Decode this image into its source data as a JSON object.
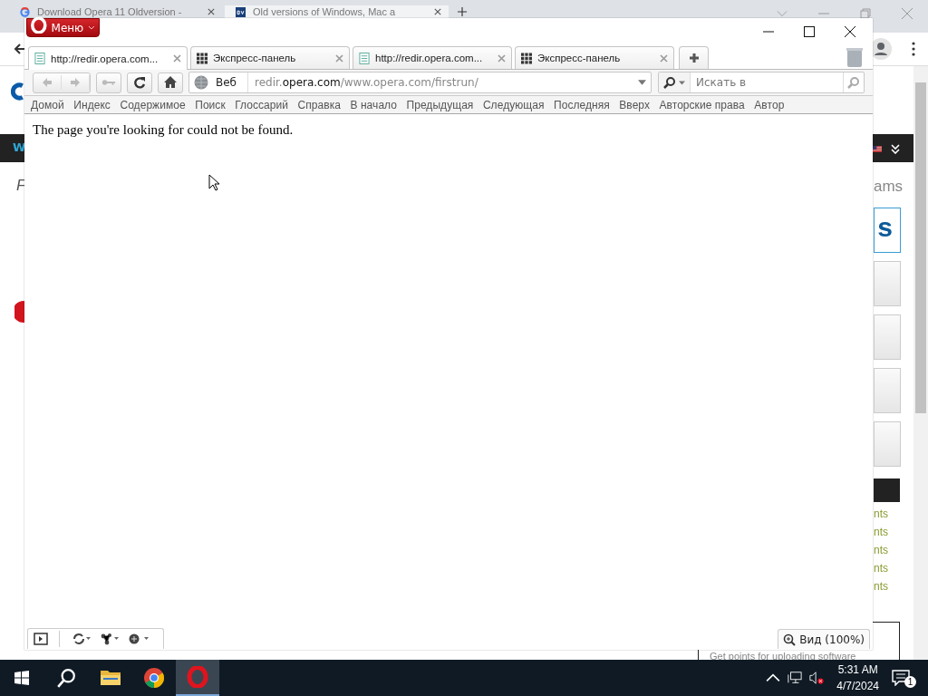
{
  "background_browser": {
    "tabs": [
      {
        "title": "Download Opera 11 Oldversion -",
        "kind": "google",
        "selected": false
      },
      {
        "title": "Old versions of Windows, Mac a",
        "kind": "ov",
        "selected": true
      }
    ],
    "page": {
      "nav_letter": "W",
      "heading_letter": "F",
      "side_heading": "ams",
      "logo_letter": "s",
      "side_links": [
        "nts",
        "nts",
        "nts",
        "nts",
        "nts"
      ],
      "footer_text": "Get points for uploading software"
    }
  },
  "opera_window": {
    "menu_label": "Меню",
    "tabs": [
      {
        "title": "http://redir.opera.com...",
        "kind": "page",
        "selected": true
      },
      {
        "title": "Экспресс-панель",
        "kind": "speed-dial",
        "selected": false
      },
      {
        "title": "http://redir.opera.com...",
        "kind": "page",
        "selected": false
      },
      {
        "title": "Экспресс-панель",
        "kind": "speed-dial",
        "selected": false
      }
    ],
    "address": {
      "label": "Веб",
      "value": "redir.**opera.com**/www.opera.com/firstrun/"
    },
    "search": {
      "placeholder": "Искать в"
    },
    "nav_links": [
      "Домой",
      "Индекс",
      "Содержимое",
      "Поиск",
      "Глоссарий",
      "Справка",
      "В начало",
      "Предыдущая",
      "Следующая",
      "Последняя",
      "Вверх",
      "Авторские права",
      "Автор"
    ],
    "page_text": "The page you're looking for could not be found.",
    "zoom_label": "Вид (100%)"
  },
  "taskbar": {
    "apps": [
      {
        "kind": "explorer",
        "selected": false
      },
      {
        "kind": "chrome",
        "selected": false
      },
      {
        "kind": "opera",
        "selected": true
      }
    ],
    "time": "5:31 AM",
    "date": "4/7/2024",
    "notification_count": "1"
  }
}
